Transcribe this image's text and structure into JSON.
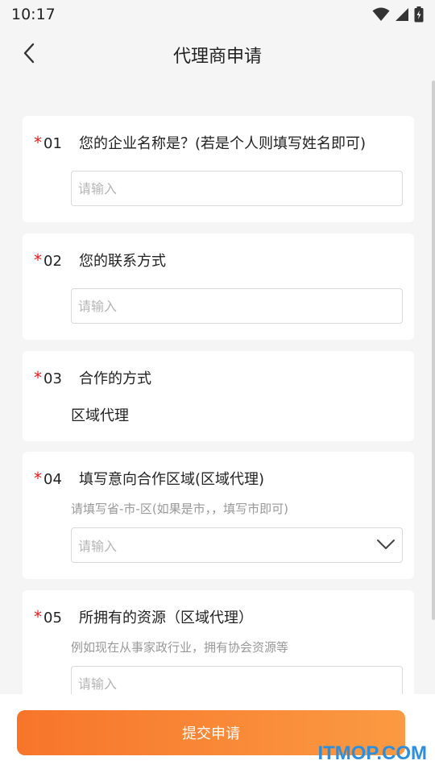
{
  "status_bar": {
    "time": "10:17",
    "icons": [
      "wifi-icon",
      "signal-icon",
      "battery-icon"
    ]
  },
  "navbar": {
    "back_icon": "chevron-left-icon",
    "title": "代理商申请"
  },
  "questions": [
    {
      "star": "*",
      "number": "01",
      "text": "您的企业名称是？(若是个人则填写姓名即可)",
      "placeholder": "请输入"
    },
    {
      "star": "*",
      "number": "02",
      "text": "您的联系方式",
      "placeholder": "请输入"
    },
    {
      "star": "*",
      "number": "03",
      "text": "合作的方式",
      "value": "区域代理"
    },
    {
      "star": "*",
      "number": "04",
      "text": "填写意向合作区域(区域代理)",
      "hint": "请填写省-市-区(如果是市，，填写市即可)",
      "placeholder": "请输入",
      "dropdown_icon": "chevron-down-icon"
    },
    {
      "star": "*",
      "number": "05",
      "text": "所拥有的资源（区域代理）",
      "hint": "例如现在从事家政行业，拥有协会资源等",
      "placeholder": "请输入"
    }
  ],
  "submit": {
    "label": "提交申请"
  },
  "watermark": "ITMOP.COM",
  "colors": {
    "accent_start": "#f7752b",
    "accent_end": "#fb9a42",
    "required_star": "#e02020",
    "watermark": "#2e8ede"
  }
}
